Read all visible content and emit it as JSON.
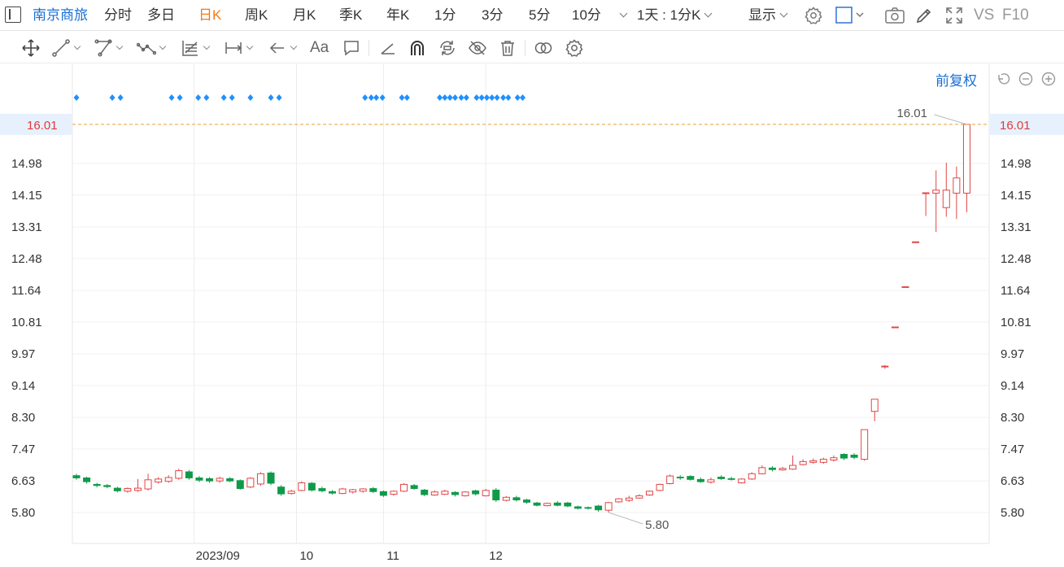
{
  "header": {
    "stock_name": "南京商旅",
    "period_tabs": [
      {
        "label": "分时",
        "active": false
      },
      {
        "label": "多日",
        "active": false
      },
      {
        "label": "日K",
        "active": true
      },
      {
        "label": "周K",
        "active": false
      },
      {
        "label": "月K",
        "active": false
      },
      {
        "label": "季K",
        "active": false
      },
      {
        "label": "年K",
        "active": false
      },
      {
        "label": "1分",
        "active": false
      },
      {
        "label": "3分",
        "active": false
      },
      {
        "label": "5分",
        "active": false
      },
      {
        "label": "10分",
        "active": false
      }
    ],
    "range_selector": "1天 : 1分K",
    "display_menu": "显示",
    "vs_label": "VS",
    "f10_label": "F10"
  },
  "toolbar": {
    "tools": [
      "move-tool",
      "line-tool",
      "channel-tool",
      "polyline-tool",
      "fib-tool",
      "measure-tool",
      "arrow-tool",
      "text-tool",
      "comment-tool",
      "angle-tool",
      "magnet-tool",
      "sync-tool",
      "hide-tool",
      "delete-tool",
      "compare-tool",
      "settings-tool"
    ],
    "text_tool_label": "Aa"
  },
  "chart": {
    "adjust_label": "前复权",
    "current_price_tag": "16.01",
    "high_label": "16.01",
    "low_label": "5.80",
    "colors": {
      "up": "#e24646",
      "down": "#0f9a4a",
      "marker": "#1e90ff",
      "price_line": "#e8a23a",
      "tag_bg": "#e6f1fd",
      "tag_text": "#e0393e"
    }
  },
  "chart_data": {
    "type": "candlestick",
    "y_ticks": [
      "5.80",
      "6.63",
      "7.47",
      "8.30",
      "9.14",
      "9.97",
      "10.81",
      "11.64",
      "12.48",
      "13.31",
      "14.15",
      "14.98",
      "16.01"
    ],
    "ylim": [
      5.36,
      16.5
    ],
    "x_tick_labels": [
      {
        "label": "2023/09",
        "index": 11.5
      },
      {
        "label": "10",
        "index": 21.5
      },
      {
        "label": "11",
        "index": 30
      },
      {
        "label": "12",
        "index": 40
      }
    ],
    "current_price": 16.01,
    "event_markers": [
      0,
      3.5,
      4.3,
      9.3,
      10.1,
      11.9,
      12.7,
      14.4,
      15.2,
      17,
      19,
      19.8,
      28.2,
      28.8,
      29.3,
      29.9,
      31.8,
      32.3,
      35.5,
      36,
      36.5,
      37,
      37.6,
      38.1,
      39.1,
      39.6,
      40.1,
      40.6,
      41.1,
      41.7,
      42.2,
      43.1,
      43.6
    ],
    "candles": [
      {
        "o": 6.78,
        "c": 6.7,
        "h": 6.82,
        "l": 6.66
      },
      {
        "o": 6.72,
        "c": 6.6,
        "h": 6.74,
        "l": 6.56
      },
      {
        "o": 6.55,
        "c": 6.5,
        "h": 6.58,
        "l": 6.46
      },
      {
        "o": 6.52,
        "c": 6.47,
        "h": 6.55,
        "l": 6.44
      },
      {
        "o": 6.45,
        "c": 6.36,
        "h": 6.48,
        "l": 6.33
      },
      {
        "o": 6.36,
        "c": 6.43,
        "h": 6.46,
        "l": 6.32
      },
      {
        "o": 6.38,
        "c": 6.44,
        "h": 6.68,
        "l": 6.34
      },
      {
        "o": 6.42,
        "c": 6.66,
        "h": 6.82,
        "l": 6.38
      },
      {
        "o": 6.6,
        "c": 6.68,
        "h": 6.73,
        "l": 6.56
      },
      {
        "o": 6.62,
        "c": 6.72,
        "h": 6.78,
        "l": 6.58
      },
      {
        "o": 6.7,
        "c": 6.9,
        "h": 6.95,
        "l": 6.66
      },
      {
        "o": 6.88,
        "c": 6.7,
        "h": 6.92,
        "l": 6.66
      },
      {
        "o": 6.72,
        "c": 6.64,
        "h": 6.76,
        "l": 6.6
      },
      {
        "o": 6.7,
        "c": 6.62,
        "h": 6.73,
        "l": 6.58
      },
      {
        "o": 6.63,
        "c": 6.7,
        "h": 6.74,
        "l": 6.58
      },
      {
        "o": 6.7,
        "c": 6.62,
        "h": 6.73,
        "l": 6.6
      },
      {
        "o": 6.65,
        "c": 6.42,
        "h": 6.67,
        "l": 6.4
      },
      {
        "o": 6.47,
        "c": 6.7,
        "h": 6.73,
        "l": 6.44
      },
      {
        "o": 6.55,
        "c": 6.82,
        "h": 6.86,
        "l": 6.5
      },
      {
        "o": 6.85,
        "c": 6.56,
        "h": 6.88,
        "l": 6.52
      }
    ],
    "candles_b": [
      {
        "o": 6.48,
        "c": 6.28,
        "h": 6.52,
        "l": 6.24
      },
      {
        "o": 6.3,
        "c": 6.36,
        "h": 6.4,
        "l": 6.27
      },
      {
        "o": 6.38,
        "c": 6.58,
        "h": 6.62,
        "l": 6.36
      },
      {
        "o": 6.58,
        "c": 6.38,
        "h": 6.6,
        "l": 6.35
      },
      {
        "o": 6.44,
        "c": 6.36,
        "h": 6.48,
        "l": 6.33
      },
      {
        "o": 6.36,
        "c": 6.3,
        "h": 6.39,
        "l": 6.27
      },
      {
        "o": 6.3,
        "c": 6.42,
        "h": 6.45,
        "l": 6.28
      },
      {
        "o": 6.34,
        "c": 6.4,
        "h": 6.42,
        "l": 6.3
      },
      {
        "o": 6.36,
        "c": 6.42,
        "h": 6.44,
        "l": 6.32
      },
      {
        "o": 6.44,
        "c": 6.34,
        "h": 6.47,
        "l": 6.31
      },
      {
        "o": 6.36,
        "c": 6.24,
        "h": 6.38,
        "l": 6.21
      },
      {
        "o": 6.28,
        "c": 6.36,
        "h": 6.38,
        "l": 6.24
      },
      {
        "o": 6.36,
        "c": 6.54,
        "h": 6.57,
        "l": 6.34
      },
      {
        "o": 6.52,
        "c": 6.42,
        "h": 6.55,
        "l": 6.4
      },
      {
        "o": 6.4,
        "c": 6.26,
        "h": 6.42,
        "l": 6.23
      },
      {
        "o": 6.26,
        "c": 6.34,
        "h": 6.38,
        "l": 6.24
      },
      {
        "o": 6.28,
        "c": 6.36,
        "h": 6.4,
        "l": 6.26
      },
      {
        "o": 6.34,
        "c": 6.26,
        "h": 6.36,
        "l": 6.22
      },
      {
        "o": 6.24,
        "c": 6.34,
        "h": 6.36,
        "l": 6.22
      },
      {
        "o": 6.38,
        "c": 6.28,
        "h": 6.4,
        "l": 6.25
      },
      {
        "o": 6.24,
        "c": 6.38,
        "h": 6.42,
        "l": 6.22
      }
    ],
    "candles_c": [
      {
        "o": 6.4,
        "c": 6.12,
        "h": 6.44,
        "l": 6.08
      },
      {
        "o": 6.12,
        "c": 6.2,
        "h": 6.23,
        "l": 6.09
      },
      {
        "o": 6.2,
        "c": 6.12,
        "h": 6.24,
        "l": 6.09
      },
      {
        "o": 6.14,
        "c": 6.06,
        "h": 6.16,
        "l": 6.03
      },
      {
        "o": 6.06,
        "c": 5.98,
        "h": 6.08,
        "l": 5.96
      },
      {
        "o": 5.98,
        "c": 6.04,
        "h": 6.06,
        "l": 5.96
      },
      {
        "o": 6.06,
        "c": 5.98,
        "h": 6.1,
        "l": 5.96
      },
      {
        "o": 6.06,
        "c": 5.96,
        "h": 6.08,
        "l": 5.94
      },
      {
        "o": 5.96,
        "c": 5.9,
        "h": 5.98,
        "l": 5.88
      },
      {
        "o": 5.94,
        "c": 5.9,
        "h": 5.96,
        "l": 5.88
      },
      {
        "o": 5.98,
        "c": 5.86,
        "h": 6.0,
        "l": 5.82
      },
      {
        "o": 5.86,
        "c": 6.06,
        "h": 6.08,
        "l": 5.8
      },
      {
        "o": 6.08,
        "c": 6.16,
        "h": 6.18,
        "l": 6.06
      },
      {
        "o": 6.12,
        "c": 6.18,
        "h": 6.24,
        "l": 6.08
      },
      {
        "o": 6.18,
        "c": 6.24,
        "h": 6.28,
        "l": 6.16
      },
      {
        "o": 6.26,
        "c": 6.36,
        "h": 6.38,
        "l": 6.24
      },
      {
        "o": 6.38,
        "c": 6.54,
        "h": 6.56,
        "l": 6.36
      },
      {
        "o": 6.56,
        "c": 6.76,
        "h": 6.8,
        "l": 6.54
      },
      {
        "o": 6.74,
        "c": 6.7,
        "h": 6.78,
        "l": 6.66
      },
      {
        "o": 6.76,
        "c": 6.66,
        "h": 6.78,
        "l": 6.64
      },
      {
        "o": 6.68,
        "c": 6.6,
        "h": 6.72,
        "l": 6.58
      }
    ],
    "candles_d": [
      {
        "o": 6.6,
        "c": 6.66,
        "h": 6.72,
        "l": 6.56
      },
      {
        "o": 6.74,
        "c": 6.68,
        "h": 6.78,
        "l": 6.66
      },
      {
        "o": 6.7,
        "c": 6.66,
        "h": 6.74,
        "l": 6.64
      },
      {
        "o": 6.58,
        "c": 6.68,
        "h": 6.7,
        "l": 6.56
      },
      {
        "o": 6.68,
        "c": 6.82,
        "h": 6.86,
        "l": 6.66
      },
      {
        "o": 6.82,
        "c": 6.98,
        "h": 7.04,
        "l": 6.8
      },
      {
        "o": 6.98,
        "c": 6.92,
        "h": 7.02,
        "l": 6.88
      },
      {
        "o": 6.92,
        "c": 6.96,
        "h": 7.0,
        "l": 6.9
      },
      {
        "o": 6.94,
        "c": 7.04,
        "h": 7.3,
        "l": 6.92
      },
      {
        "o": 7.06,
        "c": 7.14,
        "h": 7.2,
        "l": 7.04
      },
      {
        "o": 7.12,
        "c": 7.16,
        "h": 7.22,
        "l": 7.08
      },
      {
        "o": 7.12,
        "c": 7.2,
        "h": 7.24,
        "l": 7.08
      },
      {
        "o": 7.18,
        "c": 7.24,
        "h": 7.3,
        "l": 7.14
      },
      {
        "o": 7.34,
        "c": 7.22,
        "h": 7.36,
        "l": 7.18
      },
      {
        "o": 7.32,
        "c": 7.24,
        "h": 7.36,
        "l": 7.2
      },
      {
        "o": 7.2,
        "c": 7.98,
        "h": 7.98,
        "l": 7.16
      },
      {
        "o": 8.46,
        "c": 8.78,
        "h": 8.78,
        "l": 8.2
      },
      {
        "o": 9.65,
        "c": 9.65,
        "h": 9.68,
        "l": 9.58
      },
      {
        "o": 10.68,
        "c": 10.68,
        "h": 10.68,
        "l": 10.68
      },
      {
        "o": 11.74,
        "c": 11.74,
        "h": 11.74,
        "l": 11.74
      },
      {
        "o": 12.92,
        "c": 12.92,
        "h": 12.92,
        "l": 12.92
      },
      {
        "o": 14.21,
        "c": 14.21,
        "h": 14.21,
        "l": 13.6
      },
      {
        "o": 14.2,
        "c": 14.28,
        "h": 14.8,
        "l": 13.18
      },
      {
        "o": 13.82,
        "c": 14.28,
        "h": 15.0,
        "l": 13.58
      },
      {
        "o": 14.2,
        "c": 14.6,
        "h": 14.9,
        "l": 13.52
      },
      {
        "o": 14.2,
        "c": 16.01,
        "h": 16.01,
        "l": 13.7
      }
    ]
  }
}
